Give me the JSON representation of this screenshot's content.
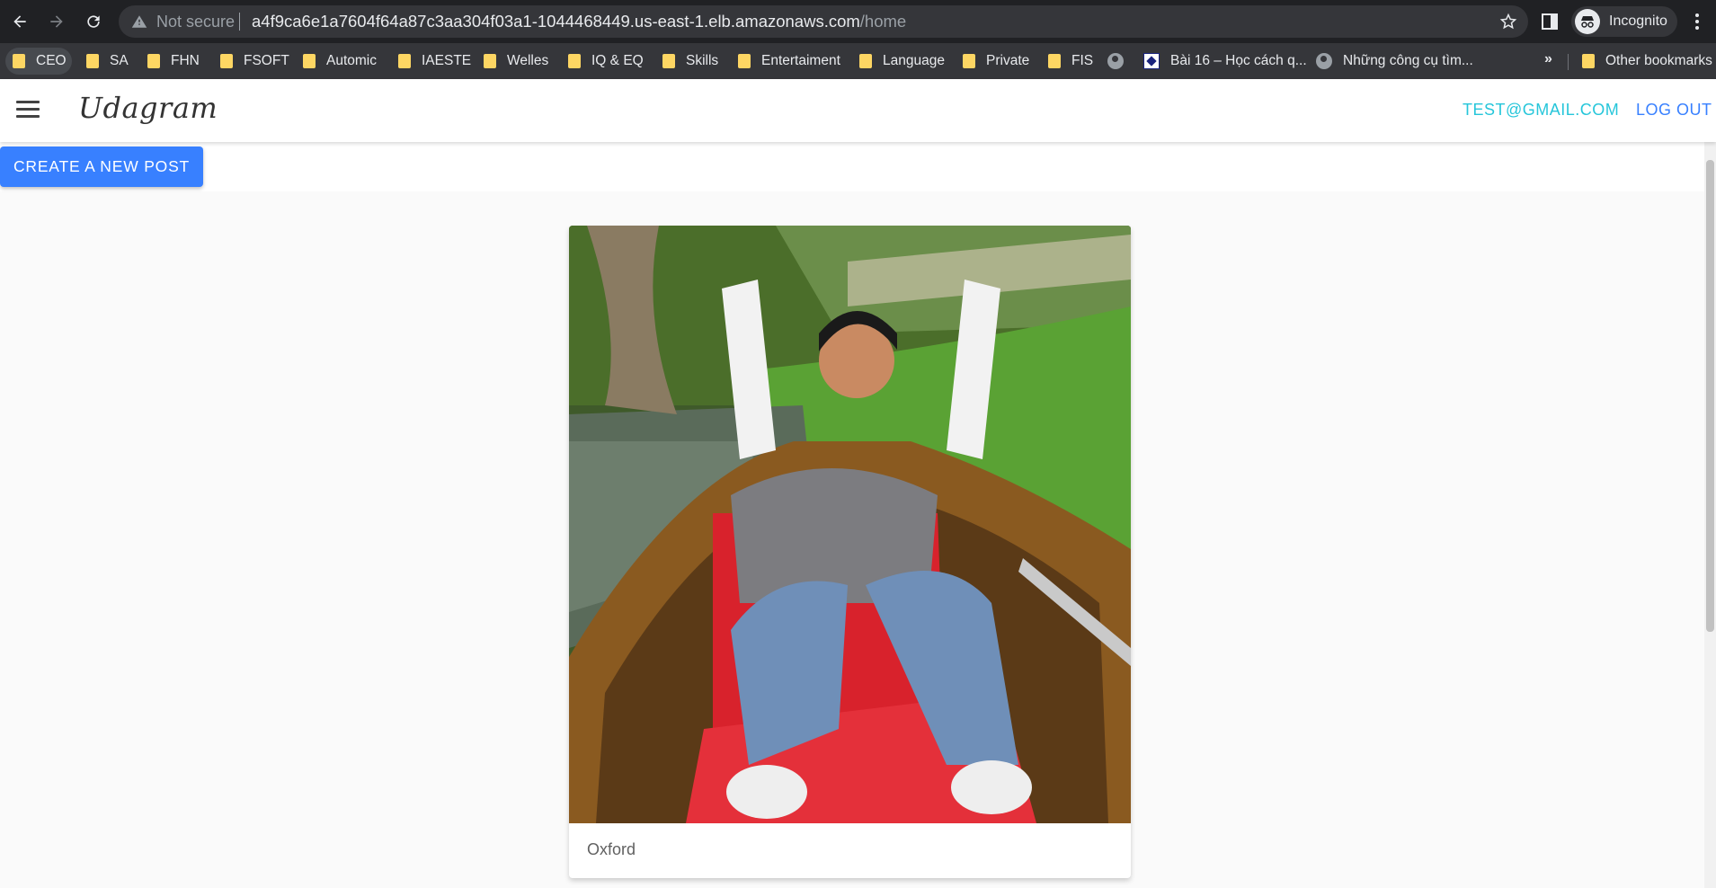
{
  "browser": {
    "not_secure_label": "Not secure",
    "url_host": "a4f9ca6e1a7604f64a87c3aa304f03a1-1044468449.us-east-1.elb.amazonaws.com",
    "url_path": "/home",
    "profile_label": "Incognito"
  },
  "bookmarks": {
    "items": [
      {
        "label": "CEO",
        "icon": "folder-icon"
      },
      {
        "label": "SA",
        "icon": "folder-icon"
      },
      {
        "label": "FHN",
        "icon": "folder-icon"
      },
      {
        "label": "FSOFT",
        "icon": "folder-icon"
      },
      {
        "label": "Automic",
        "icon": "folder-icon"
      },
      {
        "label": "IAESTE",
        "icon": "folder-icon"
      },
      {
        "label": "Welles",
        "icon": "folder-icon"
      },
      {
        "label": "IQ & EQ",
        "icon": "folder-icon"
      },
      {
        "label": "Skills",
        "icon": "folder-icon"
      },
      {
        "label": "Entertaiment",
        "icon": "folder-icon"
      },
      {
        "label": "Language",
        "icon": "folder-icon"
      },
      {
        "label": "Private",
        "icon": "folder-icon"
      },
      {
        "label": "FIS",
        "icon": "folder-icon"
      },
      {
        "label": "",
        "icon": "globe-icon"
      },
      {
        "label": "Bài 16 – Học cách q...",
        "icon": "site-icon"
      },
      {
        "label": "Những công cụ tìm...",
        "icon": "globe-icon"
      }
    ],
    "overflow_label": "»",
    "other_label": "Other bookmarks"
  },
  "app": {
    "brand": "Udagram",
    "user_email": "TEST@GMAIL.COM",
    "logout_label": "LOG OUT",
    "create_post_label": "CREATE A NEW POST"
  },
  "feed": {
    "items": [
      {
        "caption": "Oxford"
      }
    ]
  },
  "colors": {
    "primary": "#3880ff",
    "email": "#26c6da",
    "chrome_dark": "#202124"
  }
}
